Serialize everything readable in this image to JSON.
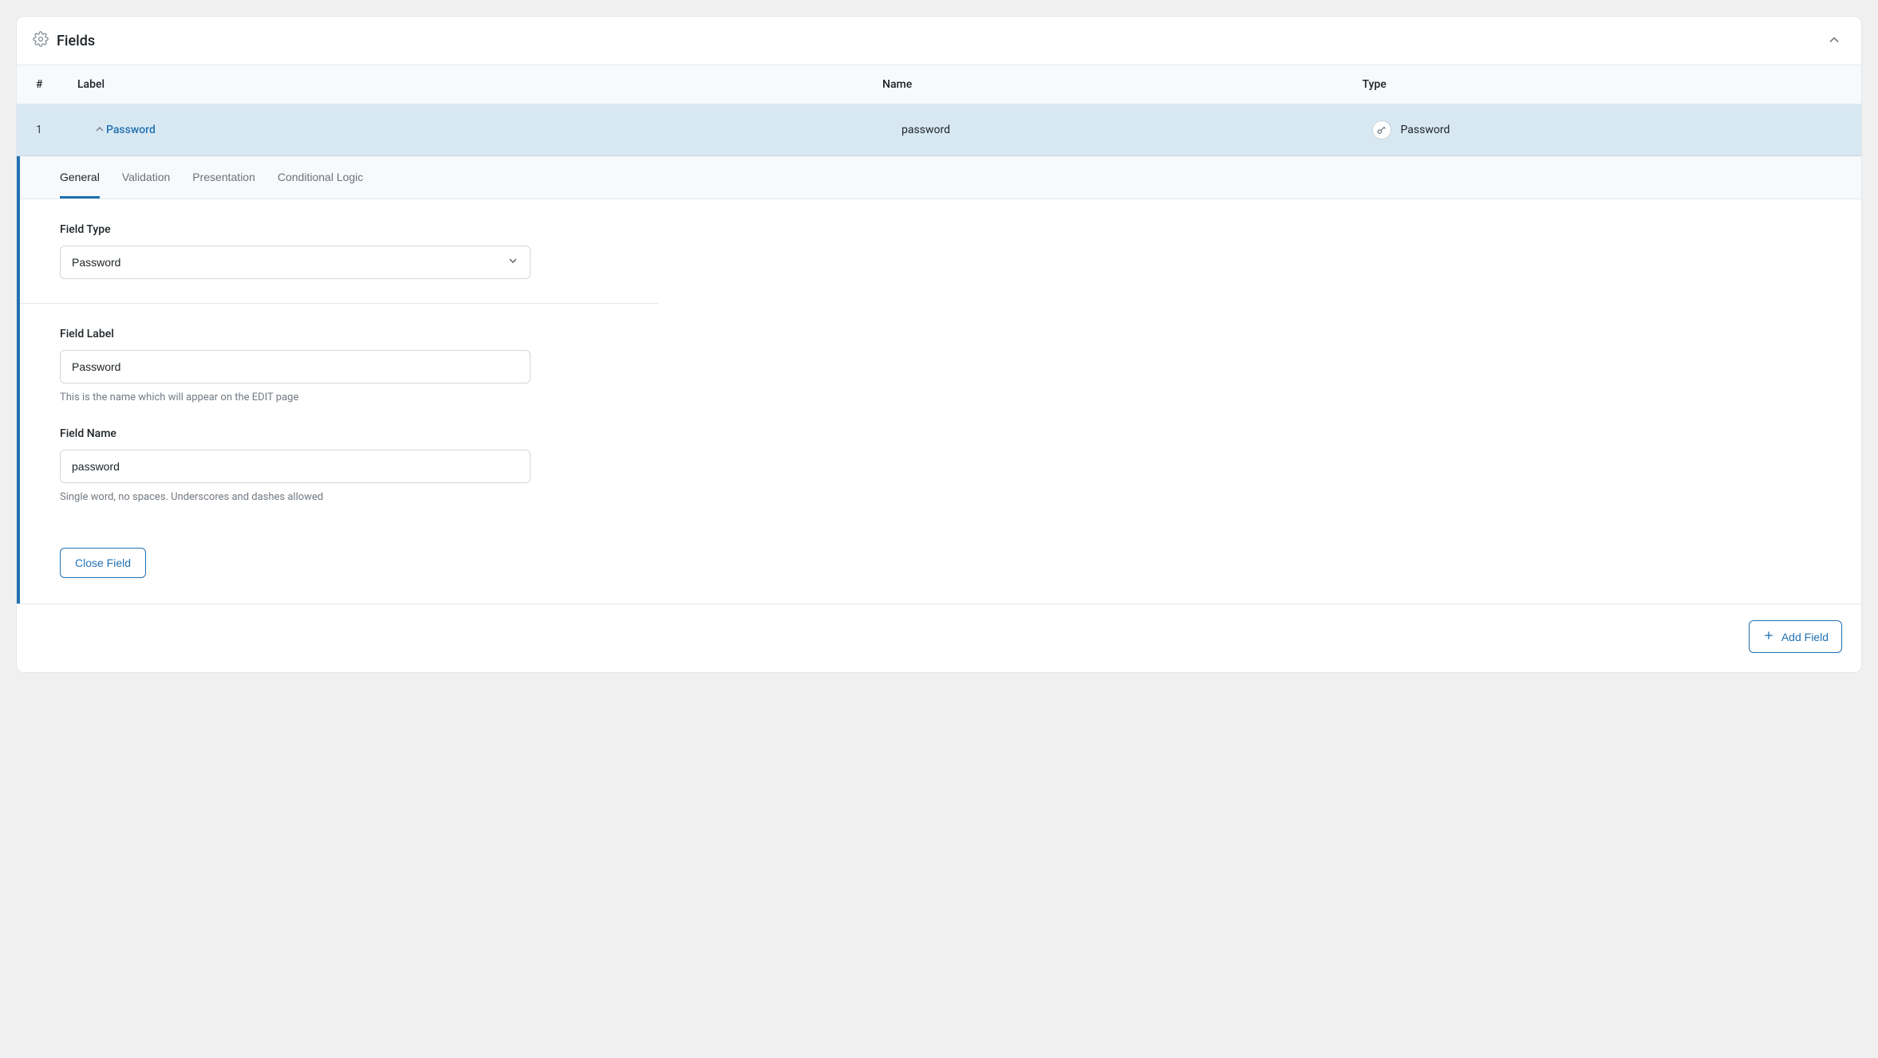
{
  "panel": {
    "title": "Fields"
  },
  "columns": {
    "num": "#",
    "label": "Label",
    "name": "Name",
    "type": "Type"
  },
  "row": {
    "index": "1",
    "label": "Password",
    "name": "password",
    "type": "Password"
  },
  "tabs": {
    "general": "General",
    "validation": "Validation",
    "presentation": "Presentation",
    "conditional": "Conditional Logic"
  },
  "editor": {
    "field_type_label": "Field Type",
    "field_type_value": "Password",
    "field_label_label": "Field Label",
    "field_label_value": "Password",
    "field_label_help": "This is the name which will appear on the EDIT page",
    "field_name_label": "Field Name",
    "field_name_value": "password",
    "field_name_help": "Single word, no spaces. Underscores and dashes allowed",
    "close_button": "Close Field"
  },
  "footer": {
    "add_field": "Add Field"
  }
}
